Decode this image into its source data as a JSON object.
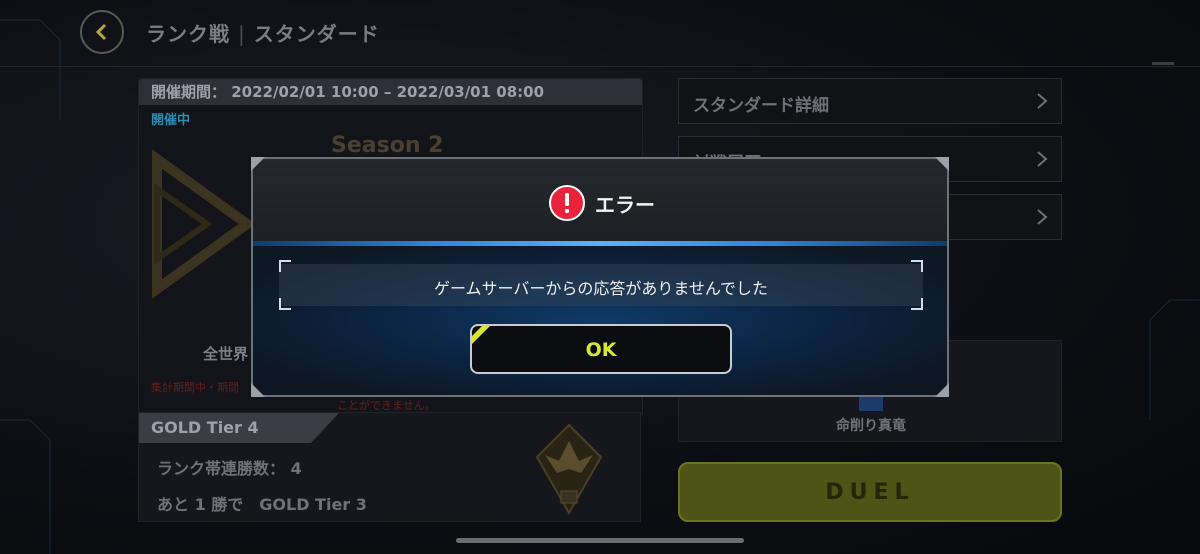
{
  "header": {
    "title_main": "ランク戦",
    "separator": "|",
    "title_sub": "スタンダード"
  },
  "left_panel": {
    "period": "開催期間： 2022/02/01 10:00 – 2022/03/01 08:00",
    "status": "開催中",
    "season": "Season 2",
    "rank_info": "全世界",
    "note1": "集計期間中・期間",
    "note2": "ことができません。"
  },
  "tier_panel": {
    "tier": "GOLD Tier 4",
    "streak": "ランク帯連勝数： 4",
    "next": "あと 1 勝で　GOLD Tier 3"
  },
  "menu": {
    "item1": "スタンダード詳細",
    "item2": "対戦履歴"
  },
  "deck": {
    "name": "命削り真竜"
  },
  "duel_button": "DUEL",
  "dialog": {
    "title": "エラー",
    "message": "ゲームサーバーからの応答がありませんでした",
    "ok_label": "OK"
  },
  "colors": {
    "error_red": "#e8233b",
    "accent_yellow": "#d7e635",
    "header_blue": "#2f82d8"
  }
}
